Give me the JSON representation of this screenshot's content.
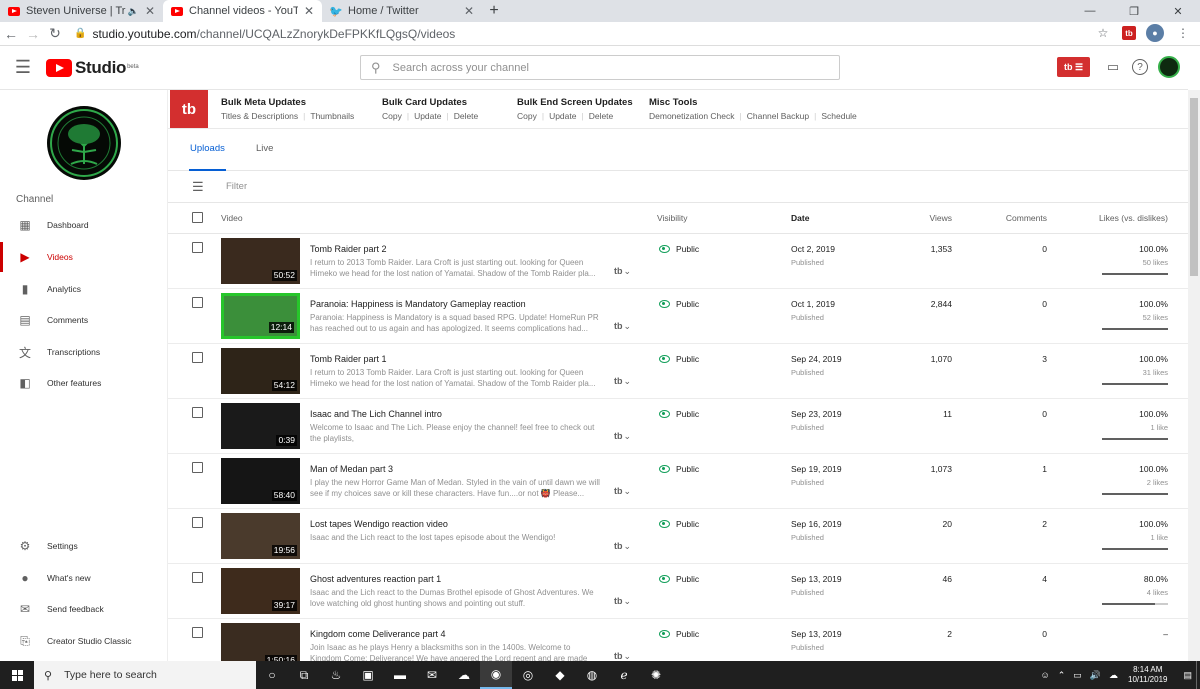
{
  "browser": {
    "tabs": [
      {
        "title": "Steven Universe | Travelling H",
        "icon": "youtube-icon"
      },
      {
        "title": "Channel videos - YouTube Studio",
        "icon": "youtube-icon"
      },
      {
        "title": "Home / Twitter",
        "icon": "twitter-icon"
      }
    ],
    "url_host": "studio.youtube.com",
    "url_path": "/channel/UCQALzZnorykDeFPKKfLQgsQ/videos"
  },
  "header": {
    "logo_text": "Studio",
    "logo_badge": "beta",
    "search_placeholder": "Search across your channel",
    "tubebuddy_label": "tb"
  },
  "sidebar": {
    "section_label": "Channel",
    "items": [
      {
        "label": "Dashboard",
        "icon": "dashboard-icon"
      },
      {
        "label": "Videos",
        "icon": "videos-icon"
      },
      {
        "label": "Analytics",
        "icon": "analytics-icon"
      },
      {
        "label": "Comments",
        "icon": "comments-icon"
      },
      {
        "label": "Transcriptions",
        "icon": "transcriptions-icon"
      },
      {
        "label": "Other features",
        "icon": "other-features-icon"
      }
    ],
    "bottom_items": [
      {
        "label": "Settings",
        "icon": "gear-icon"
      },
      {
        "label": "What's new",
        "icon": "whats-new-icon"
      },
      {
        "label": "Send feedback",
        "icon": "feedback-icon"
      },
      {
        "label": "Creator Studio Classic",
        "icon": "classic-studio-icon"
      }
    ],
    "active_item": "Videos"
  },
  "tubebuddy": {
    "logo": "tb",
    "groups": [
      {
        "title": "Bulk Meta Updates",
        "links": [
          "Titles & Descriptions",
          "Thumbnails"
        ]
      },
      {
        "title": "Bulk Card Updates",
        "links": [
          "Copy",
          "Update",
          "Delete"
        ]
      },
      {
        "title": "Bulk End Screen Updates",
        "links": [
          "Copy",
          "Update",
          "Delete"
        ]
      },
      {
        "title": "Misc Tools",
        "links": [
          "Demonetization Check",
          "Channel Backup",
          "Schedule"
        ]
      }
    ]
  },
  "tabs": {
    "uploads": "Uploads",
    "live": "Live"
  },
  "filter": {
    "placeholder": "Filter"
  },
  "table": {
    "columns": {
      "video": "Video",
      "visibility": "Visibility",
      "date": "Date",
      "views": "Views",
      "comments": "Comments",
      "likes": "Likes (vs. dislikes)"
    },
    "rows": [
      {
        "title": "Tomb Raider part 2",
        "description": "I return to 2013 Tomb Raider. Lara Croft is just starting out. looking for Queen Himeko we head for the lost nation of Yamatai. Shadow of the Tomb Raider pla...",
        "duration": "50:52",
        "visibility": "Public",
        "date": "Oct 2, 2019",
        "status": "Published",
        "views": "1,353",
        "comments": "0",
        "like_pct": "100.0%",
        "likes": "50 likes",
        "like_ratio": 1.0,
        "thumb_color": "#3a2a1e"
      },
      {
        "title": "Paranoia: Happiness is Mandatory Gameplay reaction",
        "description": "Paranoia: Happiness is Mandatory is a squad based RPG. Update! HomeRun PR has reached out to us again and has apologized. It seems complications had...",
        "duration": "12:14",
        "visibility": "Public",
        "date": "Oct 1, 2019",
        "status": "Published",
        "views": "2,844",
        "comments": "0",
        "like_pct": "100.0%",
        "likes": "52 likes",
        "like_ratio": 1.0,
        "thumb_color": "#3b8f3a"
      },
      {
        "title": "Tomb Raider part 1",
        "description": "I return to 2013 Tomb Raider. Lara Croft is just starting out. looking for Queen Himeko we head for the lost nation of Yamatai. Shadow of the Tomb Raider pla...",
        "duration": "54:12",
        "visibility": "Public",
        "date": "Sep 24, 2019",
        "status": "Published",
        "views": "1,070",
        "comments": "3",
        "like_pct": "100.0%",
        "likes": "31 likes",
        "like_ratio": 1.0,
        "thumb_color": "#2e2418"
      },
      {
        "title": "Isaac and The Lich Channel intro",
        "description": "Welcome to Isaac and The Lich. Please enjoy the channel! feel free to check out the playlists,",
        "duration": "0:39",
        "visibility": "Public",
        "date": "Sep 23, 2019",
        "status": "Published",
        "views": "11",
        "comments": "0",
        "like_pct": "100.0%",
        "likes": "1 like",
        "like_ratio": 1.0,
        "thumb_color": "#1a1a1a"
      },
      {
        "title": "Man of Medan part 3",
        "description": "I play the new Horror Game Man of Medan. Styled in the vain of until dawn we will see if my choices save or kill these characters. Have fun....or not 👹 Please...",
        "duration": "58:40",
        "visibility": "Public",
        "date": "Sep 19, 2019",
        "status": "Published",
        "views": "1,073",
        "comments": "1",
        "like_pct": "100.0%",
        "likes": "2 likes",
        "like_ratio": 1.0,
        "thumb_color": "#151515"
      },
      {
        "title": "Lost tapes Wendigo reaction video",
        "description": "Isaac and the Lich react to the lost tapes episode about the Wendigo!",
        "duration": "19:56",
        "visibility": "Public",
        "date": "Sep 16, 2019",
        "status": "Published",
        "views": "20",
        "comments": "2",
        "like_pct": "100.0%",
        "likes": "1 like",
        "like_ratio": 1.0,
        "thumb_color": "#4a3a2c"
      },
      {
        "title": "Ghost adventures reaction part 1",
        "description": "Isaac and the Lich react to the Dumas Brothel episode of Ghost Adventures. We love watching old ghost hunting shows and pointing out stuff.",
        "duration": "39:17",
        "visibility": "Public",
        "date": "Sep 13, 2019",
        "status": "Published",
        "views": "46",
        "comments": "4",
        "like_pct": "80.0%",
        "likes": "4 likes",
        "like_ratio": 0.8,
        "thumb_color": "#3e2b1c"
      },
      {
        "title": "Kingdom come Deliverance part 4",
        "description": "Join Isaac as he plays Henry a blacksmiths son in the 1400s. Welcome to Kingdom Come: Deliverance! We have angered the Lord regent and are made to...",
        "duration": "1:50:16",
        "visibility": "Public",
        "date": "Sep 13, 2019",
        "status": "Published",
        "views": "2",
        "comments": "0",
        "like_pct": "–",
        "likes": "",
        "like_ratio": 0,
        "thumb_color": "#3a2c20"
      }
    ]
  },
  "taskbar": {
    "search_placeholder": "Type here to search",
    "time": "8:14 AM",
    "date": "10/11/2019"
  },
  "colors": {
    "accent_red": "#cc0000",
    "link_blue": "#065fd4",
    "public_green": "#0f9d58"
  }
}
